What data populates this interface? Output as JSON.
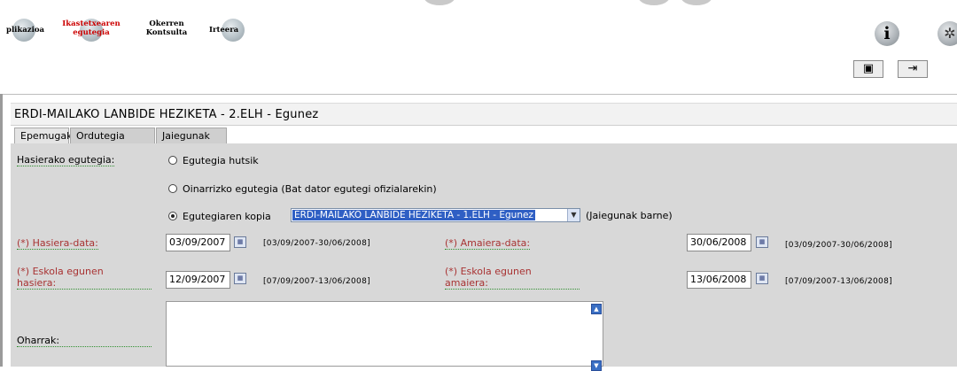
{
  "nav": {
    "items": [
      {
        "label": "plikazioa"
      },
      {
        "label": "Ikastetxearen egutegia"
      },
      {
        "label": "Okerren Kontsulta"
      },
      {
        "label": "Irteera"
      }
    ]
  },
  "header": {
    "title": "ERDI-MAILAKO LANBIDE HEZIKETA - 2.ELH - Egunez"
  },
  "tabs": [
    {
      "label": "Epemugak"
    },
    {
      "label": "Ordutegia"
    },
    {
      "label": "Jaiegunak"
    }
  ],
  "form": {
    "hasierako_label": "Hasierako egutegia:",
    "options": [
      {
        "label": "Egutegia hutsik",
        "selected": false
      },
      {
        "label": "Oinarrizko egutegia (Bat dator egutegi ofizialarekin)",
        "selected": false
      },
      {
        "label": "Egutegiaren kopia",
        "selected": true
      }
    ],
    "copy_select_value": "ERDI-MAILAKO LANBIDE HEZIKETA - 1.ELH - Egunez",
    "copy_suffix": "(Jaiegunak barne)",
    "hasiera_data": {
      "label": "(*) Hasiera-data:",
      "value": "03/09/2007",
      "range": "[03/09/2007-30/06/2008]"
    },
    "amaiera_data": {
      "label": "(*) Amaiera-data:",
      "value": "30/06/2008",
      "range": "[03/09/2007-30/06/2008]"
    },
    "eskola_hasiera": {
      "label_line1": "(*) Eskola egunen",
      "label_line2": "hasiera:",
      "value": "12/09/2007",
      "range": "[07/09/2007-13/06/2008]"
    },
    "eskola_amaiera": {
      "label_line1": "(*) Eskola egunen",
      "label_line2": "amaiera:",
      "value": "13/06/2008",
      "range": "[07/09/2007-13/06/2008]"
    },
    "oharrak_label": "Oharrak:",
    "oharrak_value": ""
  },
  "colors": {
    "required_label": "#a83232",
    "selection_blue": "#2f5fc4",
    "panel_bg": "#d8d8d8"
  }
}
